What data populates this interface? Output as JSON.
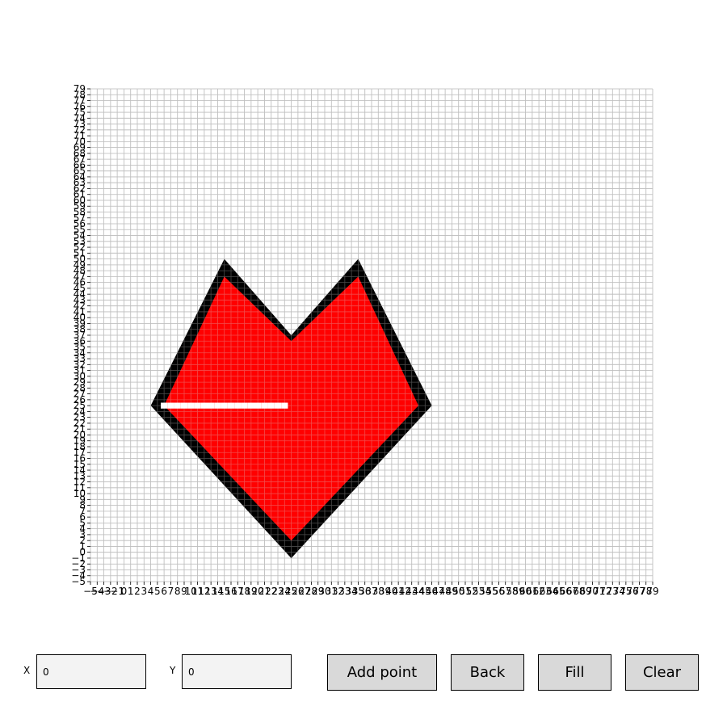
{
  "chart_data": {
    "type": "grid-polygon-editor",
    "xlim": [
      -5,
      79
    ],
    "ylim": [
      -5,
      79
    ],
    "xticks": [
      -5,
      -4,
      -3,
      -2,
      -1,
      0,
      1,
      2,
      3,
      4,
      5,
      6,
      7,
      8,
      9,
      10,
      11,
      12,
      13,
      14,
      15,
      16,
      17,
      18,
      19,
      20,
      21,
      22,
      23,
      24,
      25,
      26,
      27,
      28,
      29,
      30,
      31,
      32,
      33,
      34,
      35,
      36,
      37,
      38,
      39,
      40,
      41,
      42,
      43,
      44,
      45,
      46,
      47,
      48,
      49,
      50,
      51,
      52,
      53,
      54,
      55,
      56,
      57,
      58,
      59,
      60,
      61,
      62,
      63,
      64,
      65,
      66,
      67,
      68,
      69,
      70,
      71,
      72,
      73,
      74,
      75,
      76,
      77,
      78,
      79
    ],
    "yticks": [
      -5,
      -4,
      -3,
      -2,
      -1,
      0,
      1,
      2,
      3,
      4,
      5,
      6,
      7,
      8,
      9,
      10,
      11,
      12,
      13,
      14,
      15,
      16,
      17,
      18,
      19,
      20,
      21,
      22,
      23,
      24,
      25,
      26,
      27,
      28,
      29,
      30,
      31,
      32,
      33,
      34,
      35,
      36,
      37,
      38,
      39,
      40,
      41,
      42,
      43,
      44,
      45,
      46,
      47,
      48,
      49,
      50,
      51,
      52,
      53,
      54,
      55,
      56,
      57,
      58,
      59,
      60,
      61,
      62,
      63,
      64,
      65,
      66,
      67,
      68,
      69,
      70,
      71,
      72,
      73,
      74,
      75,
      76,
      77,
      78,
      79
    ],
    "grid": true,
    "polygon_outer": [
      [
        4,
        25
      ],
      [
        15,
        50
      ],
      [
        25,
        37
      ],
      [
        35,
        50
      ],
      [
        46,
        25
      ],
      [
        25,
        -1
      ]
    ],
    "polygon_inner": [
      [
        6,
        25
      ],
      [
        15,
        47
      ],
      [
        25,
        36
      ],
      [
        35,
        47
      ],
      [
        44,
        25
      ],
      [
        25,
        2
      ]
    ],
    "outline_color": "#000000",
    "fill_color": "#ff0000",
    "marker_row": {
      "y": 25,
      "x_from": 6,
      "x_to": 24,
      "color": "#ffffff"
    }
  },
  "controls": {
    "x_label": "X",
    "x_value": "0",
    "y_label": "Y",
    "y_value": "0",
    "add_point_label": "Add point",
    "back_label": "Back",
    "fill_label": "Fill",
    "clear_label": "Clear"
  }
}
